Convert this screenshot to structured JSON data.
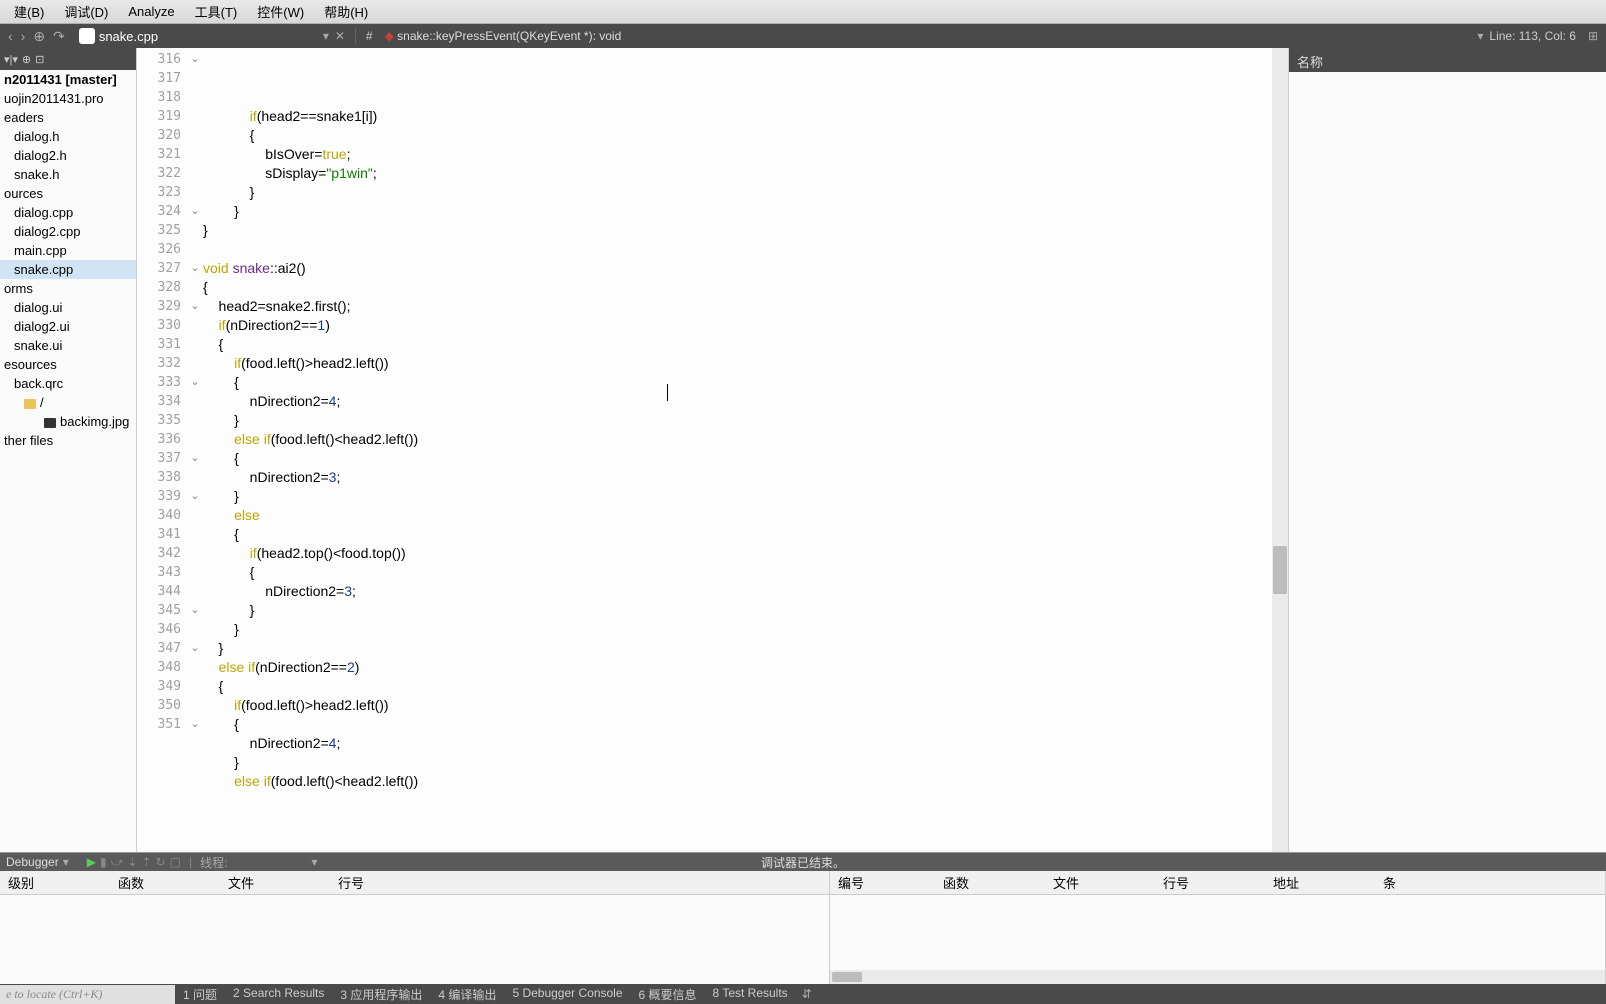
{
  "menu": {
    "items": [
      "建(B)",
      "调试(D)",
      "Analyze",
      "工具(T)",
      "控件(W)",
      "帮助(H)"
    ]
  },
  "toolbar": {
    "tab": "snake.cpp",
    "crumb": "snake::keyPressEvent(QKeyEvent *): void",
    "pos": "Line: 113, Col: 6"
  },
  "sidebar": {
    "root": "n2011431 [master]",
    "items": [
      {
        "t": "uojin2011431.pro",
        "ind": 1
      },
      {
        "t": "eaders",
        "ind": 1
      },
      {
        "t": "dialog.h",
        "ind": 2
      },
      {
        "t": "dialog2.h",
        "ind": 2
      },
      {
        "t": "snake.h",
        "ind": 2
      },
      {
        "t": "ources",
        "ind": 1
      },
      {
        "t": "dialog.cpp",
        "ind": 2
      },
      {
        "t": "dialog2.cpp",
        "ind": 2
      },
      {
        "t": "main.cpp",
        "ind": 2
      },
      {
        "t": "snake.cpp",
        "ind": 2,
        "sel": true
      },
      {
        "t": "orms",
        "ind": 1
      },
      {
        "t": "dialog.ui",
        "ind": 2
      },
      {
        "t": "dialog2.ui",
        "ind": 2
      },
      {
        "t": "snake.ui",
        "ind": 2
      },
      {
        "t": "esources",
        "ind": 1
      },
      {
        "t": "back.qrc",
        "ind": 2
      },
      {
        "t": "/",
        "ind": 3,
        "folder": true
      },
      {
        "t": "backimg.jpg",
        "ind": 4,
        "icon": true
      },
      {
        "t": "ther files",
        "ind": 1
      }
    ]
  },
  "outline_header": "名称",
  "editor": {
    "start": 316,
    "folds": {
      "316": true,
      "324": true,
      "327": true,
      "329": true,
      "333": true,
      "337": true,
      "339": true,
      "345": true,
      "347": true,
      "351": true
    },
    "lines": [
      {
        "tokens": [
          {
            "s": "            "
          },
          {
            "s": "if",
            "c": "kw"
          },
          {
            "s": "(head2==snake1[i])"
          }
        ]
      },
      {
        "tokens": [
          {
            "s": "            {"
          }
        ]
      },
      {
        "tokens": [
          {
            "s": "                bIsOver="
          },
          {
            "s": "true",
            "c": "bool"
          },
          {
            "s": ";"
          }
        ]
      },
      {
        "tokens": [
          {
            "s": "                sDisplay="
          },
          {
            "s": "\"p1win\"",
            "c": "str"
          },
          {
            "s": ";"
          }
        ]
      },
      {
        "tokens": [
          {
            "s": "            }"
          }
        ]
      },
      {
        "tokens": [
          {
            "s": "        }"
          }
        ]
      },
      {
        "tokens": [
          {
            "s": "}"
          }
        ]
      },
      {
        "tokens": [
          {
            "s": ""
          }
        ]
      },
      {
        "tokens": [
          {
            "s": "void",
            "c": "kw"
          },
          {
            "s": " "
          },
          {
            "s": "snake",
            "c": "typ"
          },
          {
            "s": "::ai2()"
          }
        ]
      },
      {
        "tokens": [
          {
            "s": "{"
          }
        ]
      },
      {
        "tokens": [
          {
            "s": "    head2=snake2.first();"
          }
        ]
      },
      {
        "tokens": [
          {
            "s": "    "
          },
          {
            "s": "if",
            "c": "kw"
          },
          {
            "s": "(nDirection2=="
          },
          {
            "s": "1",
            "c": "num"
          },
          {
            "s": ")"
          }
        ]
      },
      {
        "tokens": [
          {
            "s": "    {"
          }
        ]
      },
      {
        "tokens": [
          {
            "s": "        "
          },
          {
            "s": "if",
            "c": "kw"
          },
          {
            "s": "(food.left()>head2.left())"
          }
        ]
      },
      {
        "tokens": [
          {
            "s": "        {"
          }
        ]
      },
      {
        "tokens": [
          {
            "s": "            nDirection2="
          },
          {
            "s": "4",
            "c": "num"
          },
          {
            "s": ";"
          }
        ]
      },
      {
        "tokens": [
          {
            "s": "        }"
          }
        ]
      },
      {
        "tokens": [
          {
            "s": "        "
          },
          {
            "s": "else",
            "c": "kw"
          },
          {
            "s": " "
          },
          {
            "s": "if",
            "c": "kw"
          },
          {
            "s": "(food.left()<head2.left())"
          }
        ]
      },
      {
        "tokens": [
          {
            "s": "        {"
          }
        ]
      },
      {
        "tokens": [
          {
            "s": "            nDirection2="
          },
          {
            "s": "3",
            "c": "num"
          },
          {
            "s": ";"
          }
        ]
      },
      {
        "tokens": [
          {
            "s": "        }"
          }
        ]
      },
      {
        "tokens": [
          {
            "s": "        "
          },
          {
            "s": "else",
            "c": "kw"
          }
        ]
      },
      {
        "tokens": [
          {
            "s": "        {"
          }
        ]
      },
      {
        "tokens": [
          {
            "s": "            "
          },
          {
            "s": "if",
            "c": "kw"
          },
          {
            "s": "(head2.top()<food.top())"
          }
        ]
      },
      {
        "tokens": [
          {
            "s": "            {"
          }
        ]
      },
      {
        "tokens": [
          {
            "s": "                nDirection2="
          },
          {
            "s": "3",
            "c": "num"
          },
          {
            "s": ";"
          }
        ]
      },
      {
        "tokens": [
          {
            "s": "            }"
          }
        ]
      },
      {
        "tokens": [
          {
            "s": "        }"
          }
        ]
      },
      {
        "tokens": [
          {
            "s": "    }"
          }
        ]
      },
      {
        "tokens": [
          {
            "s": "    "
          },
          {
            "s": "else",
            "c": "kw"
          },
          {
            "s": " "
          },
          {
            "s": "if",
            "c": "kw"
          },
          {
            "s": "(nDirection2=="
          },
          {
            "s": "2",
            "c": "num"
          },
          {
            "s": ")"
          }
        ]
      },
      {
        "tokens": [
          {
            "s": "    {"
          }
        ]
      },
      {
        "tokens": [
          {
            "s": "        "
          },
          {
            "s": "if",
            "c": "kw"
          },
          {
            "s": "(food.left()>head2.left())"
          }
        ]
      },
      {
        "tokens": [
          {
            "s": "        {"
          }
        ]
      },
      {
        "tokens": [
          {
            "s": "            nDirection2="
          },
          {
            "s": "4",
            "c": "num"
          },
          {
            "s": ";"
          }
        ]
      },
      {
        "tokens": [
          {
            "s": "        }"
          }
        ]
      },
      {
        "tokens": [
          {
            "s": "        "
          },
          {
            "s": "else",
            "c": "kw"
          },
          {
            "s": " "
          },
          {
            "s": "if",
            "c": "kw"
          },
          {
            "s": "(food.left()<head2.left())"
          }
        ]
      }
    ]
  },
  "debugger": {
    "label": "Debugger",
    "thread_label": "线程:",
    "status": "调试器已结束。"
  },
  "panel_left_cols": [
    "级别",
    "函数",
    "文件",
    "行号"
  ],
  "panel_right_cols": [
    "编号",
    "函数",
    "文件",
    "行号",
    "地址",
    "条"
  ],
  "locator_placeholder": "e to locate (Ctrl+K)",
  "status_tabs": [
    "1 问题",
    "2 Search Results",
    "3 应用程序输出",
    "4 编译输出",
    "5 Debugger Console",
    "6 概要信息",
    "8 Test Results"
  ]
}
